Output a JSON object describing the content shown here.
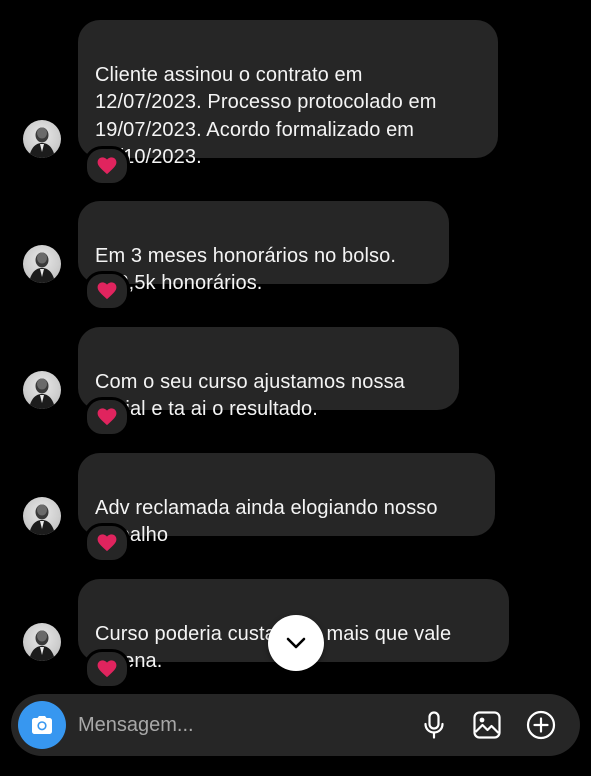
{
  "messages": [
    {
      "text": "Cliente assinou o contrato em\n12/07/2023. Processo protocolado em\n19/07/2023. Acordo formalizado em\n13/10/2023.",
      "reaction": "heart"
    },
    {
      "text": "Em 3 meses honorários no bolso.\n122,5k honorários.",
      "reaction": "heart"
    },
    {
      "text": "Com o seu curso ajustamos nossa\ninicial e ta ai o resultado.",
      "reaction": "heart"
    },
    {
      "text": "Adv reclamada ainda elogiando nosso\ntrabalho",
      "reaction": "heart"
    },
    {
      "text": "Curso poderia custar 10x mais que vale\na pena.",
      "reaction": "heart"
    }
  ],
  "composer": {
    "placeholder": "Mensagem...",
    "icons": [
      "camera-icon",
      "microphone-icon",
      "gallery-icon",
      "plus-circle-icon"
    ]
  },
  "colors": {
    "background": "#000000",
    "bubble": "#262626",
    "accent": "#3797f0",
    "reaction": "#e0245e"
  }
}
